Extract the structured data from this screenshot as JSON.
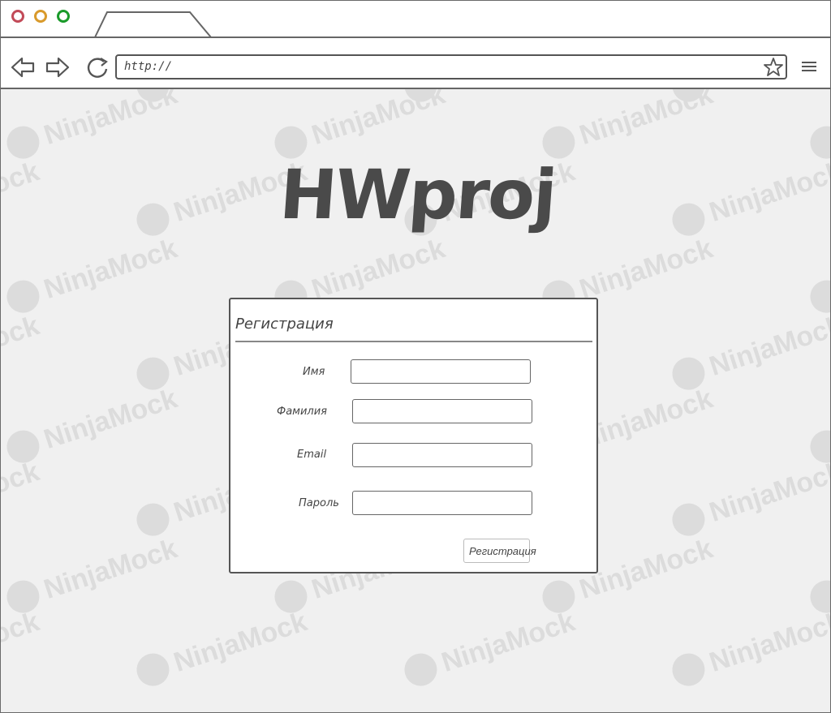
{
  "browser": {
    "url": "http://",
    "watermark_text": "NinjaMock"
  },
  "page": {
    "logo_text": "HWproj"
  },
  "form": {
    "title": "Регистрация",
    "fields": [
      {
        "label": "Имя",
        "value": ""
      },
      {
        "label": "Фамилия",
        "value": ""
      },
      {
        "label": "Email",
        "value": ""
      },
      {
        "label": "Пароль",
        "value": ""
      }
    ],
    "submit_label": "Регистрация"
  },
  "colors": {
    "close_dot": "#c24a58",
    "minimize_dot": "#d99a2b",
    "maximize_dot": "#1a9a2a",
    "background": "#f0f0f0",
    "stroke": "#555555"
  }
}
